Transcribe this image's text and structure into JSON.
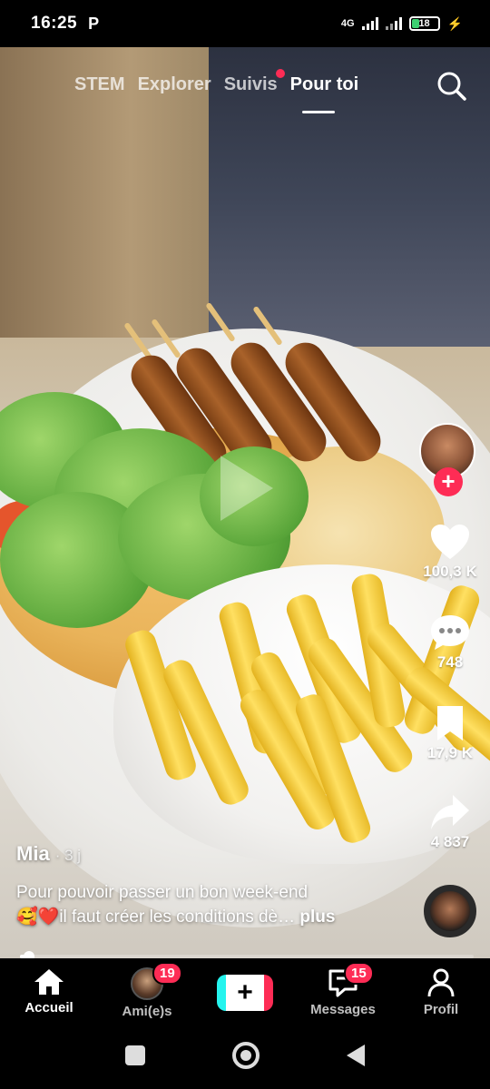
{
  "status_bar": {
    "time": "16:25",
    "app_icon": "P",
    "network": "4G",
    "battery": "18"
  },
  "top_tabs": [
    {
      "label": "STEM"
    },
    {
      "label": "Explorer"
    },
    {
      "label": "Suivis"
    },
    {
      "label": "Pour toi"
    }
  ],
  "actions": {
    "likes": "100,3 K",
    "comments": "748",
    "saves": "17,9 K",
    "shares": "4 837"
  },
  "post": {
    "author": "Mia",
    "age": "· 3 j",
    "caption": "Pour pouvoir passer un bon week-end",
    "caption_line2": "il faut créer les conditions dè…",
    "more": "plus",
    "progress_fraction": 0.02
  },
  "bottom_nav": {
    "home": "Accueil",
    "friends": "Ami(e)s",
    "friends_badge": "19",
    "create": "+",
    "messages": "Messages",
    "messages_badge": "15",
    "profile": "Profil"
  },
  "colors": {
    "accent": "#fe2c55",
    "cyan": "#25f4ee"
  }
}
